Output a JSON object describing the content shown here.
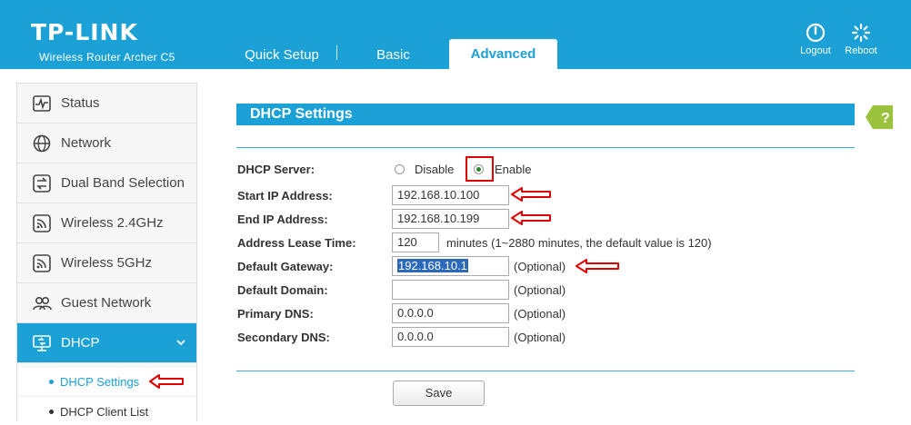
{
  "header": {
    "brand": "TP-LINK",
    "model": "Wireless Router Archer C5",
    "tabs": [
      "Quick Setup",
      "Basic",
      "Advanced"
    ],
    "logout_label": "Logout",
    "reboot_label": "Reboot"
  },
  "sidebar": {
    "items": [
      "Status",
      "Network",
      "Dual Band Selection",
      "Wireless 2.4GHz",
      "Wireless 5GHz",
      "Guest Network",
      "DHCP"
    ],
    "subitems": [
      "DHCP Settings",
      "DHCP Client List"
    ]
  },
  "section": {
    "title": "DHCP Settings",
    "help_label": "?"
  },
  "form": {
    "dhcp_server_label": "DHCP Server:",
    "disable_label": "Disable",
    "enable_label": "Enable",
    "dhcp_server_value": "Enable",
    "start_ip_label": "Start IP Address:",
    "start_ip": "192.168.10.100",
    "end_ip_label": "End IP Address:",
    "end_ip": "192.168.10.199",
    "lease_label": "Address Lease Time:",
    "lease_value": "120",
    "lease_note": "minutes (1~2880 minutes, the default value is 120)",
    "gateway_label": "Default Gateway:",
    "gateway": "192.168.10.1",
    "domain_label": "Default Domain:",
    "domain": "",
    "primary_dns_label": "Primary DNS:",
    "primary_dns": "0.0.0.0",
    "secondary_dns_label": "Secondary DNS:",
    "secondary_dns": "0.0.0.0",
    "optional": "(Optional)",
    "save_label": "Save"
  },
  "colors": {
    "brand_blue": "#1ba1d6",
    "annotation_red": "#e00000"
  }
}
